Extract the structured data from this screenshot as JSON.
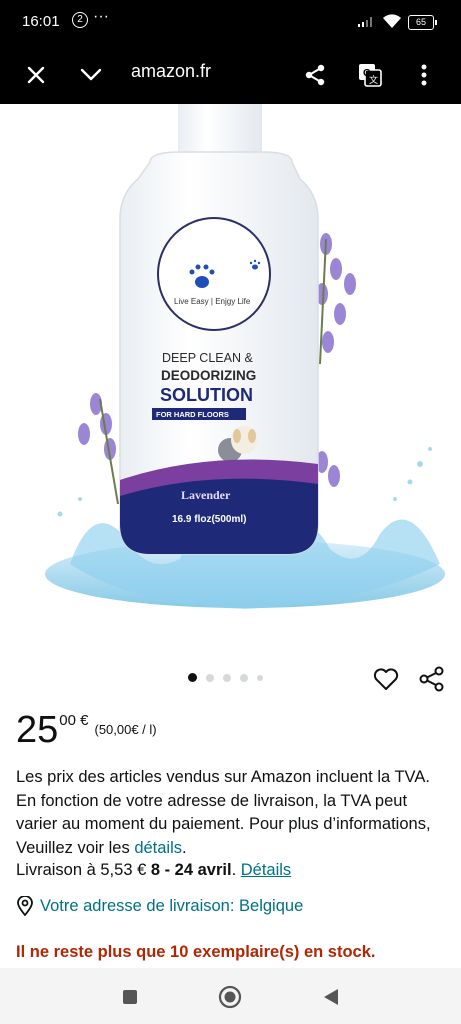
{
  "status_bar": {
    "time": "16:01",
    "notification_count": "2",
    "more": "···",
    "battery": "65"
  },
  "top_bar": {
    "url": "amazon.fr"
  },
  "product_image": {
    "deep_clean": "DEEP CLEAN &",
    "deodorizing": "DEODORIZING",
    "solution": "SOLUTION",
    "for_hard_floors": "FOR HARD FLOORS",
    "tagline": "Live Easy | Enjgy Life",
    "scent": "Lavender",
    "volume": "16.9 floz(500ml)"
  },
  "carousel": {
    "count": 5,
    "active_index": 0
  },
  "price": {
    "whole": "25",
    "fraction": "00 €",
    "unit": "(50,00€ / l)"
  },
  "tva": {
    "text": "Les prix des articles vendus sur Amazon incluent la TVA. En fonction de votre adresse de livraison, la TVA peut varier au moment du paiement. Pour plus d’informations, Veuillez voir les ",
    "link": "détails",
    "end": "."
  },
  "delivery": {
    "prefix": "Livraison à 5,53 € ",
    "dates": "8 - 24 avril",
    "sep": ". ",
    "link": "Détails"
  },
  "address": {
    "text": "Votre adresse de livraison: Belgique"
  },
  "stock": {
    "text": "Il ne reste plus que 10 exemplaire(s) en stock."
  },
  "colors": {
    "link": "#007185",
    "stock": "#b12704",
    "label_navy": "#1e2a78",
    "label_purple": "#7b3fa0"
  }
}
